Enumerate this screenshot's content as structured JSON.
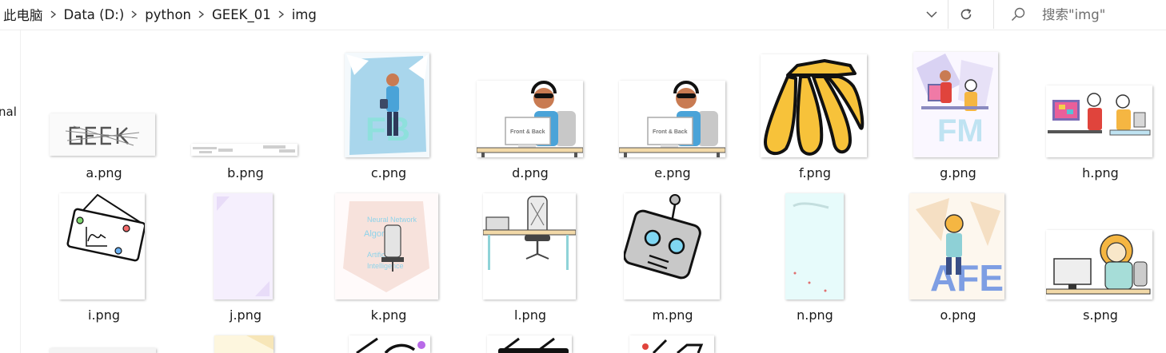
{
  "breadcrumb": [
    "此电脑",
    "Data (D:)",
    "python",
    "GEEK_01",
    "img"
  ],
  "search": {
    "placeholder": "搜索\"img\""
  },
  "nav_pane": {
    "partial_label": "nal"
  },
  "thumb_texts": {
    "front_back": "Front & Back"
  },
  "files": [
    "a.png",
    "b.png",
    "c.png",
    "d.png",
    "e.png",
    "f.png",
    "g.png",
    "h.png",
    "i.png",
    "j.png",
    "k.png",
    "l.png",
    "m.png",
    "n.png",
    "o.png",
    "s.png"
  ],
  "icons": {
    "breadcrumb_separator": "chevron-right-icon",
    "history_dropdown": "chevron-down-icon",
    "refresh": "refresh-icon",
    "search": "search-icon"
  }
}
